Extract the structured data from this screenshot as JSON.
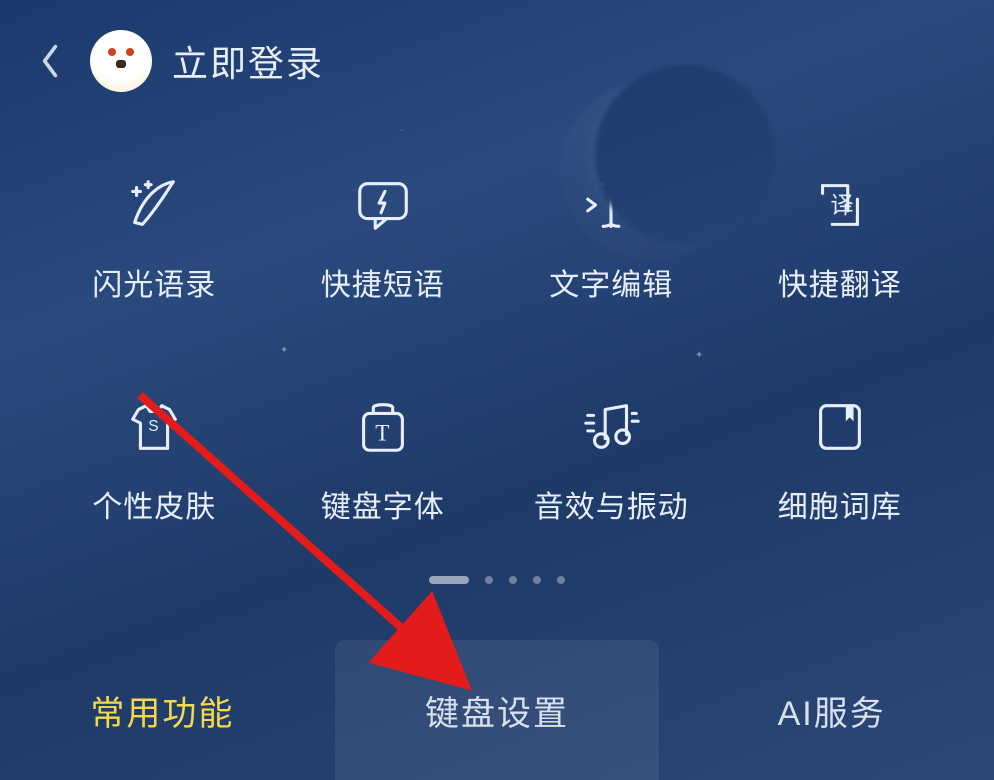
{
  "header": {
    "login_label": "立即登录"
  },
  "grid": [
    {
      "icon": "feather-sparkle",
      "label": "闪光语录"
    },
    {
      "icon": "chat-bolt",
      "label": "快捷短语"
    },
    {
      "icon": "text-cursor",
      "label": "文字编辑"
    },
    {
      "icon": "translate",
      "label": "快捷翻译"
    },
    {
      "icon": "shirt",
      "label": "个性皮肤"
    },
    {
      "icon": "font-bag",
      "label": "键盘字体"
    },
    {
      "icon": "music-vibrate",
      "label": "音效与振动"
    },
    {
      "icon": "dictionary",
      "label": "细胞词库"
    }
  ],
  "pager": {
    "count": 5,
    "active": 0
  },
  "tabs": [
    {
      "label": "常用功能",
      "active": true
    },
    {
      "label": "键盘设置",
      "active": false
    },
    {
      "label": "AI服务",
      "active": false
    }
  ],
  "annotation": {
    "arrow_target": "tab-keyboard-settings"
  }
}
